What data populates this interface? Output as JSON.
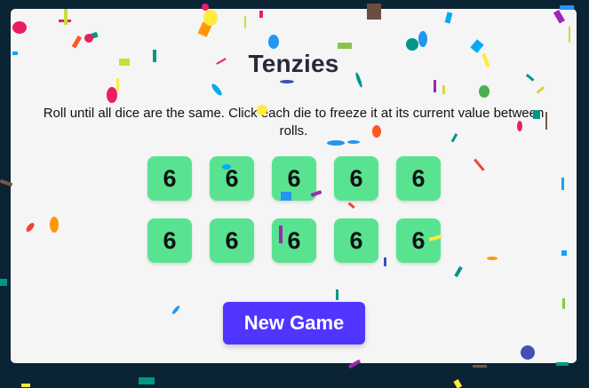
{
  "game": {
    "title": "Tenzies",
    "instructions": "Roll until all dice are the same. Click each die to freeze it at its current value between rolls.",
    "dice": [
      {
        "value": "6",
        "held": false
      },
      {
        "value": "6",
        "held": false
      },
      {
        "value": "6",
        "held": false
      },
      {
        "value": "6",
        "held": false
      },
      {
        "value": "6",
        "held": false
      },
      {
        "value": "6",
        "held": false
      },
      {
        "value": "6",
        "held": false
      },
      {
        "value": "6",
        "held": false
      },
      {
        "value": "6",
        "held": false
      },
      {
        "value": "6",
        "held": false
      }
    ],
    "button_label": "New Game"
  },
  "colors": {
    "page_background": "#0b2434",
    "card_background": "#f5f5f5",
    "die_face": "#59e391",
    "button": "#5035ff",
    "confetti": [
      "#f44336",
      "#e91e63",
      "#9c27b0",
      "#2196f3",
      "#03a9f4",
      "#009688",
      "#4caf50",
      "#8bc34a",
      "#cddc39",
      "#ffeb3b",
      "#ffc107",
      "#ff9800",
      "#795548"
    ]
  }
}
